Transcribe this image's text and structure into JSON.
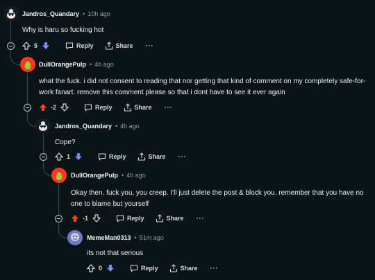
{
  "comments": [
    {
      "user": "Jandros_Quandary",
      "time": "10h ago",
      "text": "Why is haru so fucking hot",
      "votes": "5",
      "vote": "down"
    },
    {
      "user": "DullOrangePulp",
      "time": "4h ago",
      "text": "what the fuck. i did not consent to reading that nor getting that kind of comment on my completely safe-for-work fanart. remove this comment please so that i dont have to see it ever again",
      "votes": "-2",
      "vote": "up"
    },
    {
      "user": "Jandros_Quandary",
      "time": "4h ago",
      "text": "Cope?",
      "votes": "1",
      "vote": "down"
    },
    {
      "user": "DullOrangePulp",
      "time": "4h ago",
      "text": "Okay then. fuck you, you creep. I'll just delete the post & block you. remember that you have no one to blame but yourself",
      "votes": "-1",
      "vote": "up"
    },
    {
      "user": "MemeMan0313",
      "time": "51m ago",
      "text": "its not that serious",
      "votes": "0",
      "vote": "down"
    }
  ],
  "labels": {
    "reply": "Reply",
    "share": "Share",
    "more": "···",
    "dot": "•"
  },
  "colors": {
    "bg": "#0b1416",
    "upvote": "#ff4500",
    "downvote": "#7193ff",
    "thread": "#3e4a52",
    "muted": "#8ba2ad"
  },
  "icons": [
    "collapse-icon",
    "upvote-icon",
    "downvote-icon",
    "reply-icon",
    "share-icon",
    "more-icon",
    "avatar-snoo-icon",
    "avatar-pear-icon"
  ]
}
